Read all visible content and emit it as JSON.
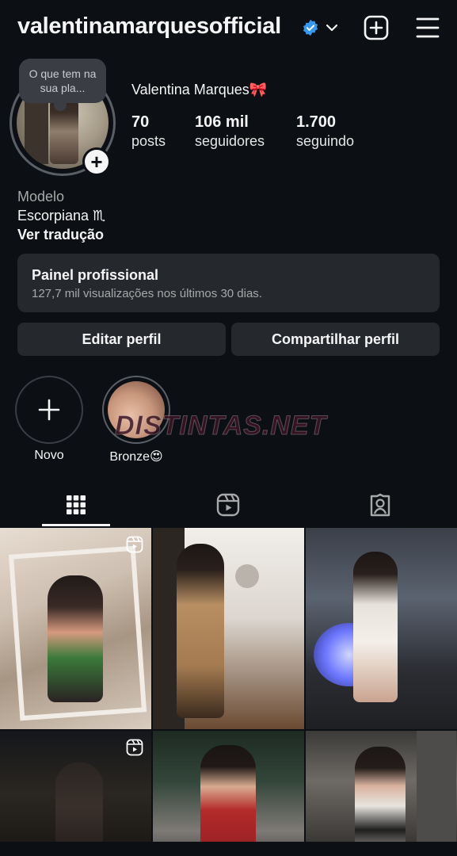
{
  "header": {
    "username": "valentinamarquesofficial",
    "icons": [
      "verified-badge-icon",
      "chevron-down-icon",
      "add-post-icon",
      "menu-icon"
    ]
  },
  "note": {
    "text": "O que tem na sua pla..."
  },
  "profile": {
    "full_name": "Valentina Marques🎀",
    "stats": [
      {
        "value": "70",
        "label": "posts"
      },
      {
        "value": "106 mil",
        "label": "seguidores"
      },
      {
        "value": "1.700",
        "label": "seguindo"
      }
    ],
    "category": "Modelo",
    "bio_line": "Escorpiana ♏",
    "translate_link": "Ver tradução"
  },
  "pro_panel": {
    "title": "Painel profissional",
    "subtitle": "127,7 mil visualizações nos últimos 30 dias."
  },
  "buttons": {
    "edit": "Editar perfil",
    "share": "Compartilhar perfil"
  },
  "highlights": [
    {
      "label": "Novo"
    },
    {
      "label": "Bronze😍"
    }
  ],
  "watermark": "DISTINTAS.NET",
  "tabs": [
    "grid-icon",
    "reels-icon",
    "tagged-icon"
  ],
  "colors": {
    "background": "#0c1014",
    "panel": "#25292e",
    "verified": "#3897f0",
    "text": "#f5f5f5",
    "muted": "#a8a8a8"
  }
}
